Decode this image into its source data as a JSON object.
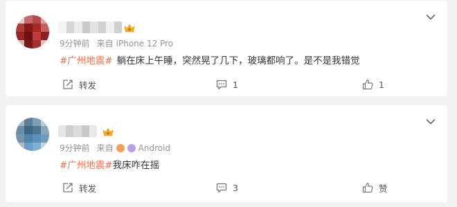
{
  "posts": [
    {
      "meta": {
        "time": "9分钟前",
        "source_prefix": "来自",
        "source": "iPhone 12 Pro"
      },
      "content": {
        "hashtag": "#广州地震#",
        "text": "躺在床上午睡，突然晃了几下，玻璃都响了。是不是我错觉"
      },
      "actions": {
        "repost_label": "转发",
        "comment_count": "1",
        "like_count": "1"
      }
    },
    {
      "meta": {
        "time": "9分钟前",
        "source_prefix": "来自",
        "source": "Android"
      },
      "content": {
        "hashtag": "#广州地震#",
        "text": "我床咋在摇"
      },
      "actions": {
        "repost_label": "转发",
        "comment_count": "3",
        "like_label": "赞"
      }
    }
  ],
  "icons": {
    "crown": "crown-badge-icon",
    "menu": "chevron-down-icon",
    "repost": "repost-icon",
    "comment": "comment-icon",
    "like": "thumbs-up-icon"
  },
  "colors": {
    "hashtag": "#eb7350",
    "meta": "#939393",
    "background": "#f2f2f2",
    "crown": "#f5b014"
  }
}
